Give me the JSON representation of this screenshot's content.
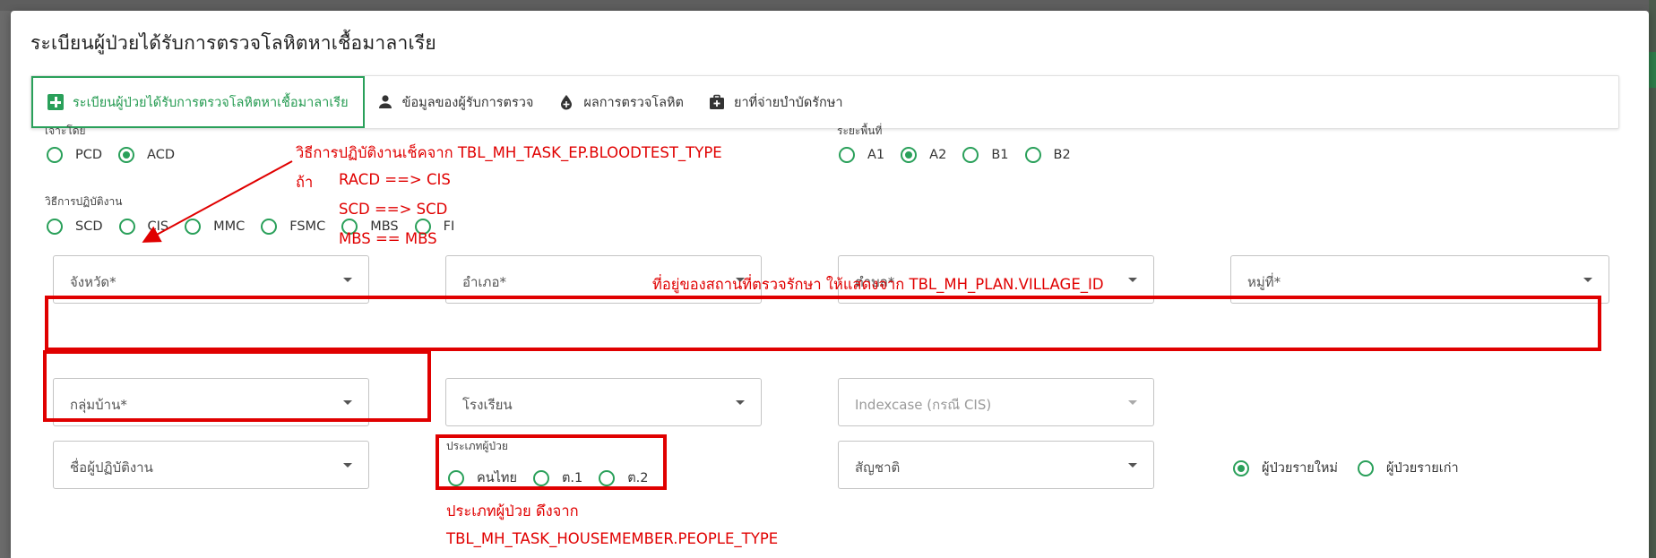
{
  "dialog": {
    "title": "ระเบียนผู้ป่วยได้รับการตรวจโลหิตหาเชื้อมาลาเรีย"
  },
  "tabs": [
    {
      "label": "ระเบียนผู้ป่วยได้รับการตรวจโลหิตหาเชื้อมาลาเรีย",
      "icon": "plus-square-icon",
      "active": true
    },
    {
      "label": "ข้อมูลของผู้รับการตรวจ",
      "icon": "person-icon",
      "active": false
    },
    {
      "label": "ผลการตรวจโลหิต",
      "icon": "blood-drop-icon",
      "active": false
    },
    {
      "label": "ยาที่จ่ายบำบัดรักษา",
      "icon": "medical-kit-icon",
      "active": false
    }
  ],
  "draw_by": {
    "label": "เจาะโดย",
    "options": [
      "PCD",
      "ACD"
    ],
    "selected": "ACD"
  },
  "area_stage": {
    "label": "ระยะพื้นที่",
    "options": [
      "A1",
      "A2",
      "B1",
      "B2"
    ],
    "selected": "A2"
  },
  "operation_method": {
    "label": "วิธีการปฏิบัติงาน",
    "options": [
      "SCD",
      "CIS",
      "MMC",
      "FSMC",
      "MBS",
      "FI"
    ],
    "selected": null
  },
  "fields": {
    "province": "จังหวัด*",
    "district": "อำเภอ*",
    "subdistrict": "ตำบล*",
    "village": "หมู่ที่*",
    "village_group": "กลุ่มบ้าน*",
    "school": "โรงเรียน",
    "indexcase": "Indexcase (กรณี CIS)",
    "operator": "ชื่อผู้ปฏิบัติงาน",
    "nationality": "สัญชาติ"
  },
  "patient_type": {
    "label": "ประเภทผู้ป่วย",
    "options": [
      "คนไทย",
      "ต.1",
      "ต.2"
    ],
    "selected": null
  },
  "patient_status": {
    "options": [
      "ผู้ป่วยรายใหม่",
      "ผู้ป่วยรายเก่า"
    ],
    "selected": "ผู้ป่วยรายใหม่"
  },
  "annotations": {
    "method_note_1": "วิธีการปฏิบัติงานเช็คจาก TBL_MH_TASK_EP.BLOODTEST_TYPE",
    "method_note_if": "ถ้า",
    "method_note_2": "RACD ==> CIS",
    "method_note_3": "SCD ==> SCD",
    "method_note_4": "MBS == MBS",
    "address_note": "ที่อยู่ของสถานที่ตรวจรักษา ให้แสดงจาก TBL_MH_PLAN.VILLAGE_ID",
    "patient_type_note_1": "ประเภทผู้ป่วย ดึงจาก",
    "patient_type_note_2": "TBL_MH_TASK_HOUSEMEMBER.PEOPLE_TYPE"
  },
  "colors": {
    "accent": "#2aa05a",
    "annotation": "#e00000"
  }
}
